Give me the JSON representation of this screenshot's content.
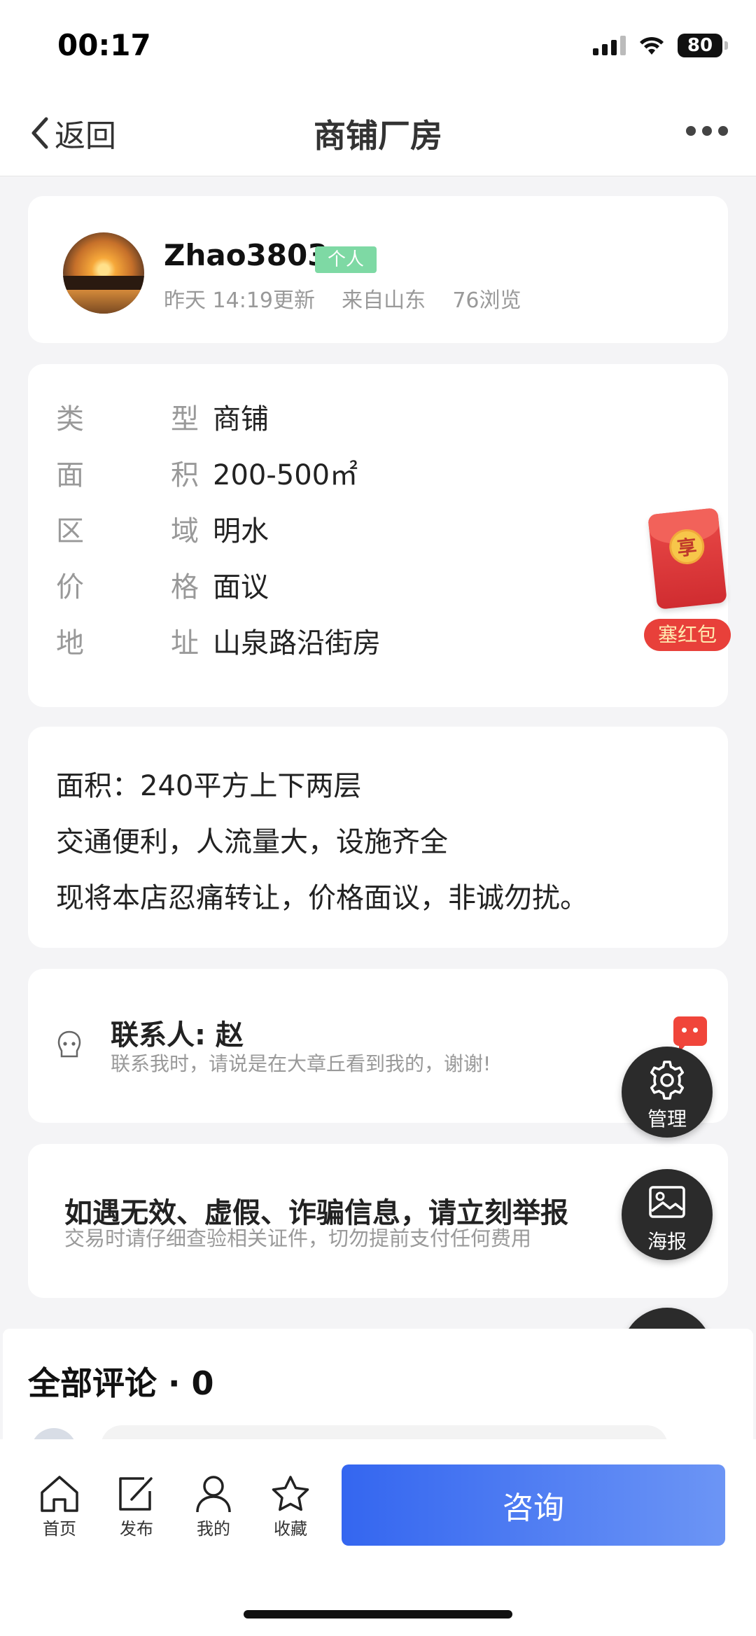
{
  "status_bar": {
    "time": "00:17",
    "battery": "80"
  },
  "nav": {
    "back_label": "返回",
    "title": "商铺厂房"
  },
  "poster": {
    "username": "Zhao3803",
    "badge": "个人",
    "updated": "昨天 14:19更新",
    "from": "来自山东",
    "views": "76浏览"
  },
  "info": [
    {
      "k1": "类",
      "k2": "型",
      "value": "商铺"
    },
    {
      "k1": "面",
      "k2": "积",
      "value": "200-500㎡"
    },
    {
      "k1": "区",
      "k2": "域",
      "value": "明水"
    },
    {
      "k1": "价",
      "k2": "格",
      "value": "面议"
    },
    {
      "k1": "地",
      "k2": "址",
      "value": "山泉路沿街房"
    }
  ],
  "description": [
    "面积：240平方上下两层",
    "交通便利，人流量大，设施齐全",
    "现将本店忍痛转让，价格面议，非诚勿扰。"
  ],
  "contact": {
    "title": "联系人: 赵",
    "subtitle": "联系我时，请说是在大章丘看到我的，谢谢!"
  },
  "report": {
    "title": "如遇无效、虚假、诈骗信息，请立刻举报",
    "subtitle": "交易时请仔细查验相关证件，切勿提前支付任何费用"
  },
  "red_packet": {
    "coin": "享",
    "label": "塞红包"
  },
  "fab": {
    "manage": "管理",
    "poster": "海报"
  },
  "comments": {
    "title": "全部评论 · 0"
  },
  "tabbar": {
    "home": "首页",
    "publish": "发布",
    "mine": "我的",
    "favorites": "收藏",
    "consult": "咨询"
  },
  "colors": {
    "accent": "#3466f0",
    "badge": "#7ed9a4",
    "red": "#e8403a"
  }
}
